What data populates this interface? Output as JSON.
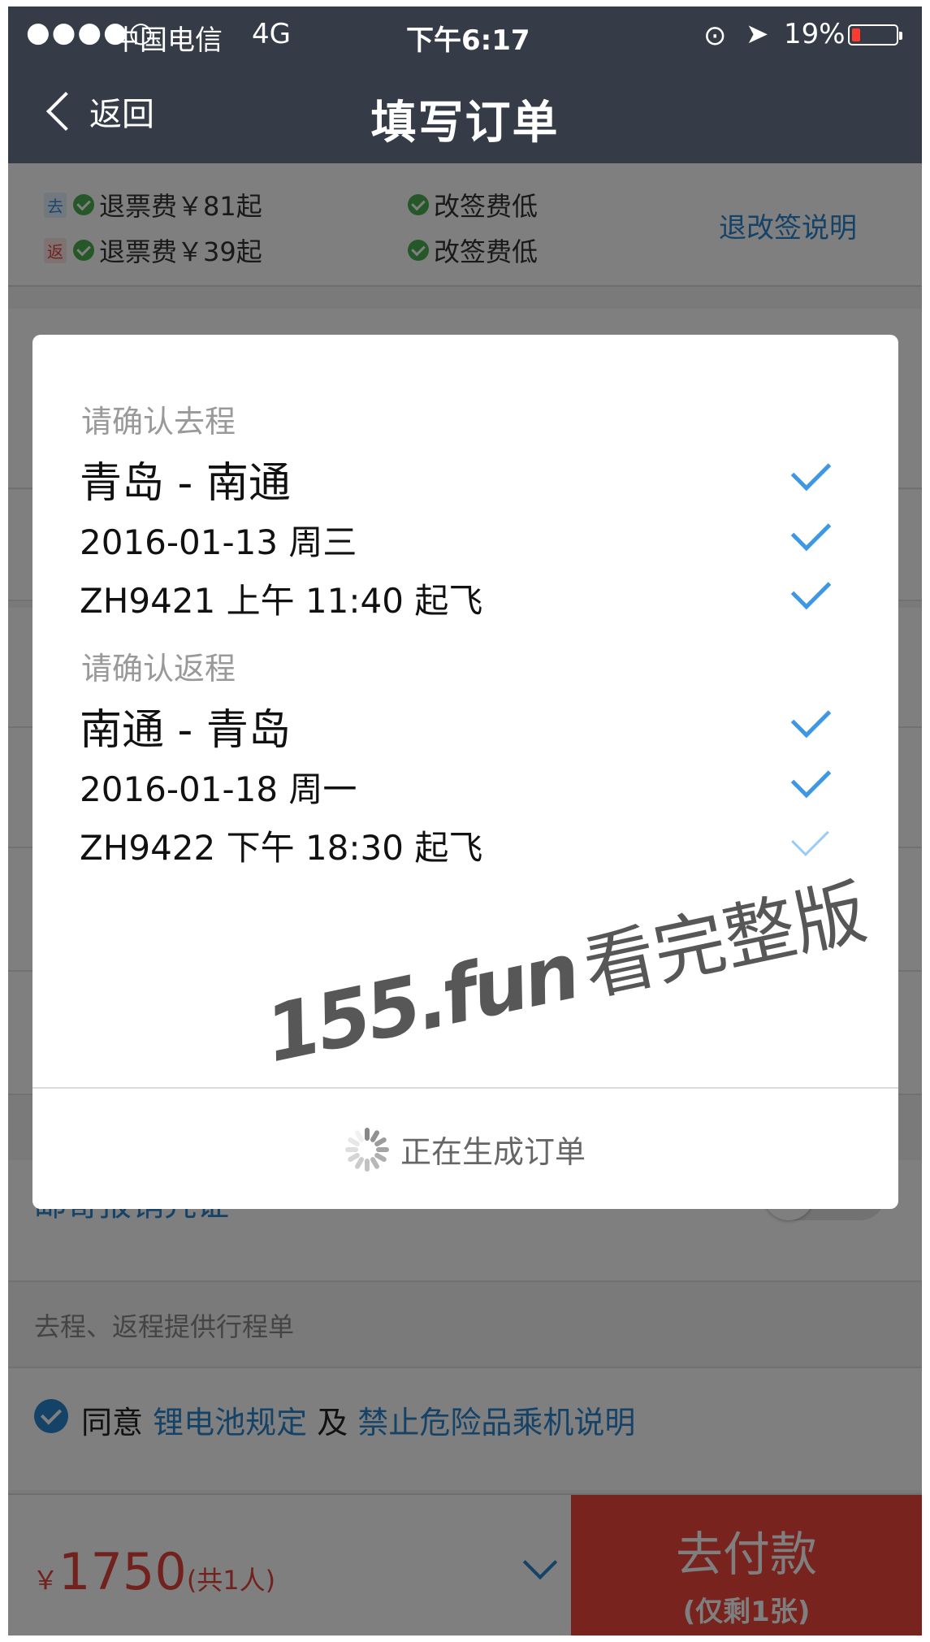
{
  "status_bar": {
    "signal": "●●●●○",
    "carrier": "中国电信",
    "network": "4G",
    "time": "下午6:17",
    "battery": "19%",
    "battery_level": 0.19
  },
  "nav": {
    "back_label": "返回",
    "title": "填写订单"
  },
  "rules": {
    "outbound_tag": "去",
    "return_tag": "返",
    "outbound_refund": "退票费￥81起",
    "return_refund": "退票费￥39起",
    "change_fee": "改签费低",
    "link": "退改签说明"
  },
  "dialog": {
    "outbound_header": "请确认去程",
    "outbound_route": "青岛 - 南通",
    "outbound_date": "2016-01-13 周三",
    "outbound_flight": "ZH9421 上午 11:40 起飞",
    "return_header": "请确认返程",
    "return_route": "南通 - 青岛",
    "return_date": "2016-01-18 周一",
    "return_flight": "ZH9422 下午 18:30 起飞",
    "loading": "正在生成订单"
  },
  "form": {
    "mail_receipt": "邮寄报销凭证",
    "itinerary_note": "去程、返程提供行程单",
    "agree_prefix": "同意",
    "agree_link1": "锂电池规定",
    "agree_mid": "及",
    "agree_link2": "禁止危险品乘机说明"
  },
  "footer": {
    "currency": "￥",
    "amount": "1750",
    "count": "(共1人)",
    "pay": "去付款",
    "remaining": "(仅剩1张)"
  },
  "watermark": {
    "text1": "155.fun",
    "text2": "看完整版"
  }
}
